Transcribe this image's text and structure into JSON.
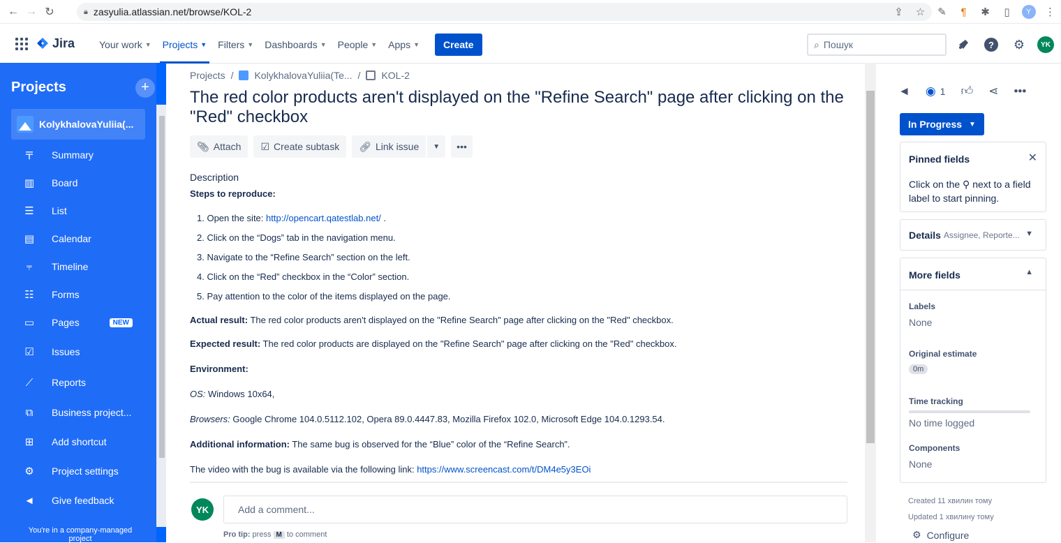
{
  "browser": {
    "url": "zasyulia.atlassian.net/browse/KOL-2",
    "profile_initial": "Y"
  },
  "topnav": {
    "logo": "Jira",
    "items": [
      {
        "label": "Your work"
      },
      {
        "label": "Projects"
      },
      {
        "label": "Filters"
      },
      {
        "label": "Dashboards"
      },
      {
        "label": "People"
      },
      {
        "label": "Apps"
      }
    ],
    "create_label": "Create",
    "search_placeholder": "Пошук",
    "avatar_initials": "YK"
  },
  "sidebar": {
    "heading": "Projects",
    "project_name": "KolykhalovaYuliia(...",
    "items": [
      {
        "label": "Summary",
        "icon": "summary-icon"
      },
      {
        "label": "Board",
        "icon": "board-icon"
      },
      {
        "label": "List",
        "icon": "list-icon"
      },
      {
        "label": "Calendar",
        "icon": "calendar-icon"
      },
      {
        "label": "Timeline",
        "icon": "timeline-icon"
      },
      {
        "label": "Forms",
        "icon": "forms-icon"
      },
      {
        "label": "Pages",
        "icon": "pages-icon",
        "badge": "NEW"
      },
      {
        "label": "Issues",
        "icon": "issues-icon"
      },
      {
        "label": "Reports",
        "icon": "reports-icon"
      },
      {
        "label": "Business project...",
        "icon": "external-link-icon"
      },
      {
        "label": "Add shortcut",
        "icon": "add-shortcut-icon"
      },
      {
        "label": "Project settings",
        "icon": "gear-icon"
      },
      {
        "label": "Give feedback",
        "icon": "megaphone-icon"
      }
    ],
    "footer": "You're in a company-managed project"
  },
  "issue": {
    "breadcrumbs": [
      "Projects",
      "KolykhalovaYuliia(Te...",
      "KOL-2"
    ],
    "title": "The red color products aren't displayed on the \"Refine Search\" page after clicking on the \"Red\" checkbox",
    "actions": {
      "attach": "Attach",
      "subtask": "Create subtask",
      "link": "Link issue"
    },
    "description_label": "Description",
    "steps_heading": "Steps to reproduce:",
    "steps": [
      {
        "prefix": "1. Open the site: ",
        "link": "http://opencart.qatestlab.net/",
        "suffix": " ."
      },
      {
        "prefix": "2. Click on the “Dogs” tab in the navigation menu.",
        "link": "",
        "suffix": ""
      },
      {
        "prefix": "3. Navigate to the “Refine Search” section on the left.",
        "link": "",
        "suffix": ""
      },
      {
        "prefix": "4. Click on the “Red” checkbox in the “Color” section.",
        "link": "",
        "suffix": ""
      },
      {
        "prefix": "5. Pay attention to the color of the items displayed on the page.",
        "link": "",
        "suffix": ""
      }
    ],
    "actual_label": "Actual result:",
    "actual_text": " The red color products aren't displayed on the \"Refine Search\" page after clicking on the \"Red\" checkbox.",
    "expected_label": "Expected result:",
    "expected_text": " The red color products are displayed on the \"Refine Search\" page after clicking on the \"Red\" checkbox.",
    "env_label": "Environment:",
    "os_label": "OS:",
    "os_text": " Windows 10x64,",
    "browsers_label": "Browsers:",
    "browsers_text": " Google Chrome 104.0.5112.102, Opera 89.0.4447.83, Mozilla Firefox 102.0, Microsoft Edge 104.0.1293.54.",
    "additional_label": "Additional information:",
    "additional_text": " The same bug is observed for the “Blue” color of the “Refine Search”.",
    "video_text": "The video with the bug is available via the following link: ",
    "video_link": "https://www.screencast.com/t/DM4e5y3EOi",
    "comment_placeholder": "Add a comment...",
    "comment_avatar": "YK",
    "pro_tip_label": "Pro tip:",
    "pro_tip_press": " press ",
    "pro_tip_key": "M",
    "pro_tip_end": " to comment"
  },
  "right": {
    "watch_count": "1",
    "status": "In Progress",
    "pinned_title": "Pinned fields",
    "pinned_text_1": "Click on the",
    "pinned_text_2": "next to a field label to start pinning.",
    "details_title": "Details",
    "details_sub": "Assignee, Reporte...",
    "more_title": "More fields",
    "fields": [
      {
        "label": "Labels",
        "value": "None"
      },
      {
        "label": "Original estimate",
        "value": "0m"
      },
      {
        "label": "Time tracking",
        "value": "No time logged"
      },
      {
        "label": "Components",
        "value": "None"
      }
    ],
    "created": "Created 11 хвилин тому",
    "updated": "Updated 1 хвилину тому",
    "configure": "Configure"
  }
}
